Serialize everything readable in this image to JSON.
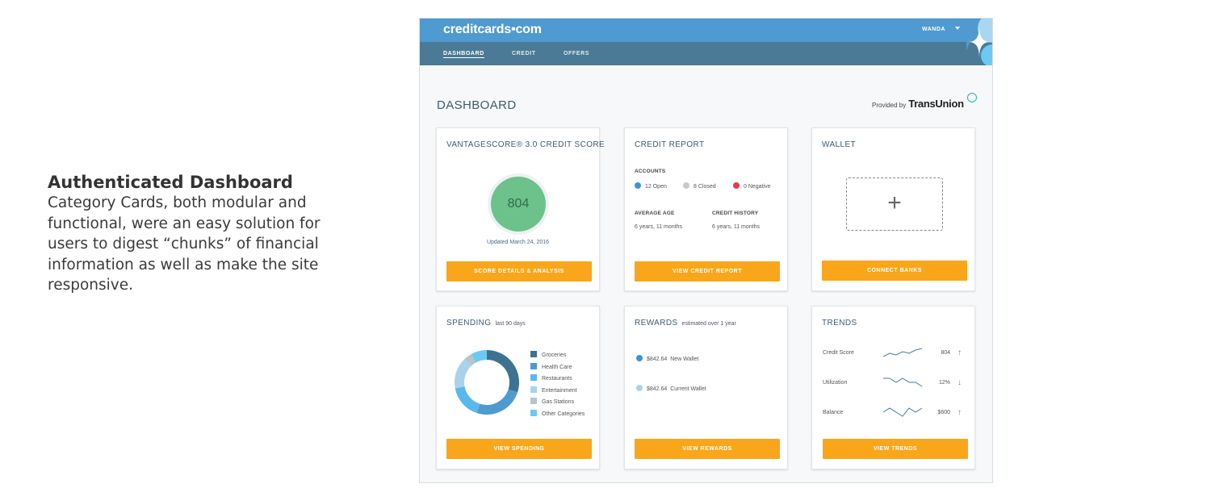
{
  "caption": {
    "title": "Authenticated Dashboard",
    "body": "Category Cards, both modular and functional, were an easy solution for users to digest “chunks” of financial information as well as make the site responsive."
  },
  "header": {
    "logo": "creditcards•com",
    "user": "WANDA"
  },
  "nav": {
    "items": [
      "DASHBOARD",
      "CREDIT",
      "OFFERS"
    ],
    "active": "DASHBOARD"
  },
  "page": {
    "title": "DASHBOARD",
    "provided_by": "Provided by",
    "provider": "TransUnion",
    "provider_icon": "tu-icon"
  },
  "score_card": {
    "title": "VANTAGESCORE® 3.0 CREDIT SCORE",
    "score": "804",
    "updated": "Updated March 24, 2016",
    "button": "SCORE DETAILS & ANALYSIS",
    "color": "#6cc28a"
  },
  "report_card": {
    "title": "CREDIT REPORT",
    "accounts_label": "ACCOUNTS",
    "accounts": [
      {
        "label": "12 Open",
        "color": "#3f93d2"
      },
      {
        "label": "8 Closed",
        "color": "#c9c9c9"
      },
      {
        "label": "0 Negative",
        "color": "#e8394a"
      }
    ],
    "average_age_label": "AVERAGE AGE",
    "average_age": "6 years, 11 months",
    "history_label": "CREDIT HISTORY",
    "history": "6 years, 11 months",
    "button": "VIEW CREDIT REPORT"
  },
  "wallet_card": {
    "title": "WALLET",
    "add_icon": "plus-icon",
    "button": "CONNECT BANKS"
  },
  "spending_card": {
    "title": "SPENDING",
    "subtitle": "last 90 days",
    "button": "VIEW SPENDING",
    "legend": [
      {
        "label": "Groceries",
        "color": "#3d7391",
        "share": 0.3
      },
      {
        "label": "Health Care",
        "color": "#4f9ad0",
        "share": 0.25
      },
      {
        "label": "Restaurants",
        "color": "#5ab8ec",
        "share": 0.17
      },
      {
        "label": "Entertainment",
        "color": "#a9d3ea",
        "share": 0.16
      },
      {
        "label": "Gas Stations",
        "color": "#b7c4cc",
        "share": 0.04
      },
      {
        "label": "Other Categories",
        "color": "#6cc9f2",
        "share": 0.08
      }
    ]
  },
  "rewards_card": {
    "title": "REWARDS",
    "subtitle": "estimated over 1 year",
    "items": [
      {
        "amount": "$842.64",
        "label": "New Wallet",
        "color": "#3f93d2"
      },
      {
        "amount": "$842.64",
        "label": "Current Wallet",
        "color": "#a9d3ea"
      }
    ],
    "button": "VIEW REWARDS"
  },
  "trends_card": {
    "title": "TRENDS",
    "rows": [
      {
        "label": "Credit Score",
        "value": "804",
        "arrow": "↑",
        "arrow_color": "#2aa37a",
        "trend": [
          3,
          5,
          4,
          6,
          5,
          7,
          8
        ]
      },
      {
        "label": "Utilization",
        "value": "12%",
        "arrow": "↓",
        "arrow_color": "#e8553a",
        "trend": [
          6,
          6,
          5,
          6,
          5,
          5,
          4
        ]
      },
      {
        "label": "Balance",
        "value": "$600",
        "arrow": "↑",
        "arrow_color": "#2aa37a",
        "trend": [
          5,
          6,
          5,
          4,
          6,
          5,
          6
        ]
      }
    ],
    "button": "VIEW TRENDS"
  }
}
